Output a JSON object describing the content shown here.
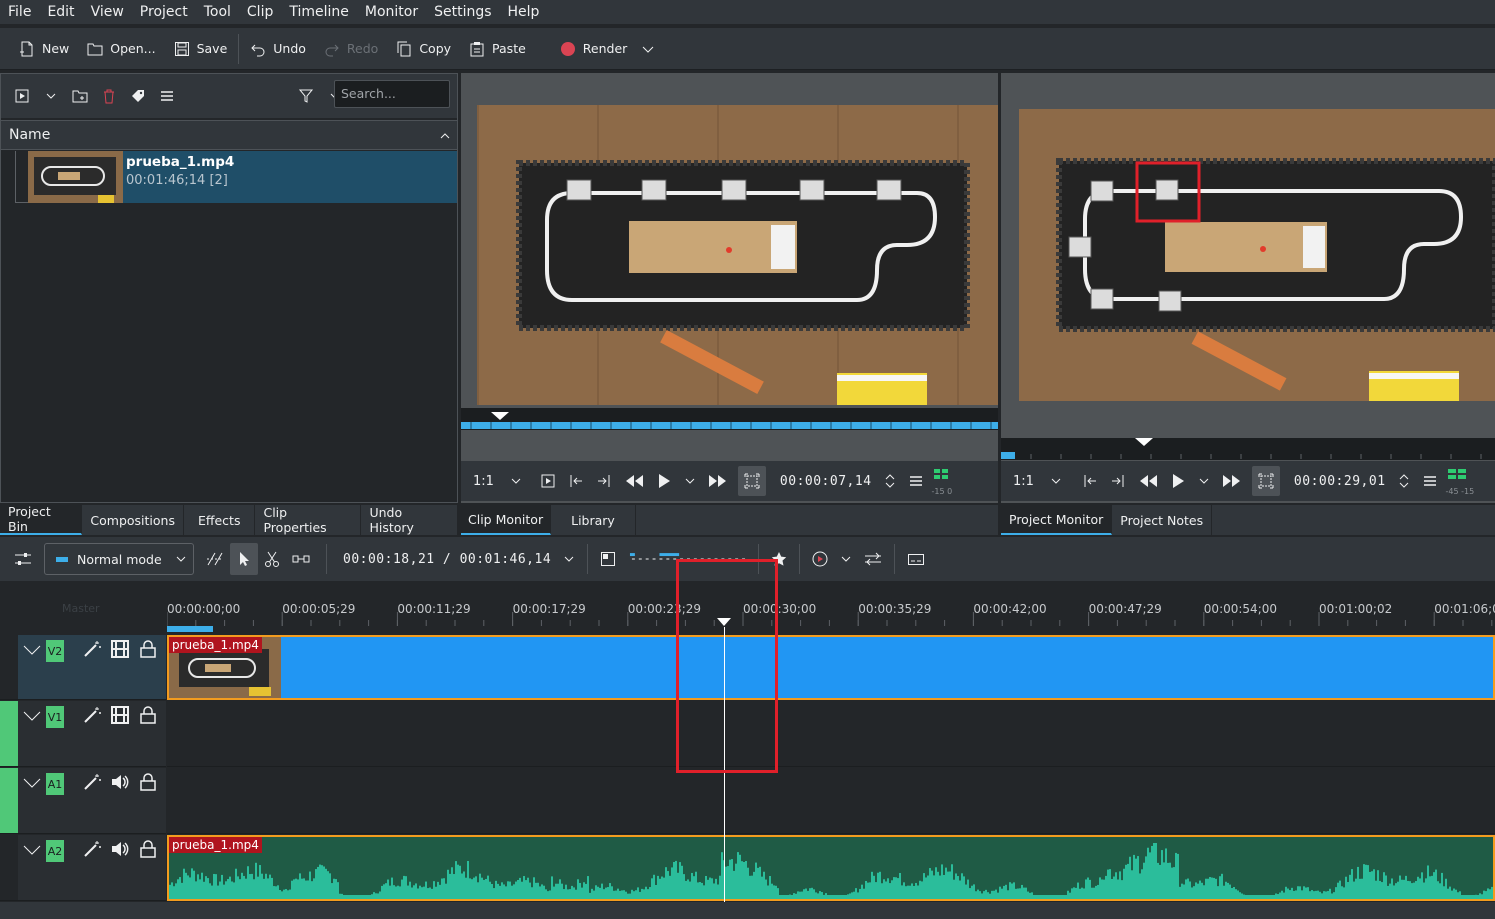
{
  "menu": [
    "File",
    "Edit",
    "View",
    "Project",
    "Tool",
    "Clip",
    "Timeline",
    "Monitor",
    "Settings",
    "Help"
  ],
  "toolbar": {
    "new": "New",
    "open": "Open...",
    "save": "Save",
    "undo": "Undo",
    "redo": "Redo",
    "copy": "Copy",
    "paste": "Paste",
    "render": "Render"
  },
  "bin": {
    "search_placeholder": "Search...",
    "column_name": "Name",
    "clip": {
      "name": "prueba_1.mp4",
      "duration": "00:01:46;14 [2]"
    }
  },
  "left_tabs": [
    "Project Bin",
    "Compositions",
    "Effects",
    "Clip Properties",
    "Undo History"
  ],
  "clip_monitor": {
    "zoom": "1:1",
    "timecode": "00:00:07,14",
    "audio_label": "-15 0",
    "tabs": [
      "Clip Monitor",
      "Library"
    ]
  },
  "project_monitor": {
    "zoom": "1:1",
    "timecode": "00:00:29,01",
    "audio_label": "-45 -15",
    "tabs": [
      "Project Monitor",
      "Project Notes"
    ]
  },
  "timeline_toolbar": {
    "mode": "Normal mode",
    "position": "00:00:18,21 / 00:01:46,14"
  },
  "timeline": {
    "master_label": "Master",
    "ruler_labels": [
      "00:00:00;00",
      "00:00:05;29",
      "00:00:11;29",
      "00:00:17;29",
      "00:00:23;29",
      "00:00:30;00",
      "00:00:35;29",
      "00:00:42;00",
      "00:00:47;29",
      "00:00:54;00",
      "00:01:00;02",
      "00:01:06;0"
    ],
    "tracks": [
      {
        "tag": "V2",
        "kind": "video",
        "clip": "prueba_1.mp4"
      },
      {
        "tag": "V1",
        "kind": "video",
        "clip": ""
      },
      {
        "tag": "A1",
        "kind": "audio",
        "clip": ""
      },
      {
        "tag": "A2",
        "kind": "audio",
        "clip": "prueba_1.mp4"
      }
    ]
  },
  "colors": {
    "accent": "#3daee9",
    "video_clip": "#2196f3",
    "audio_clip": "#2bbd9b",
    "track_tag": "#50c878",
    "highlight_box": "#e0202a",
    "clip_label_bg": "#b0141e"
  }
}
